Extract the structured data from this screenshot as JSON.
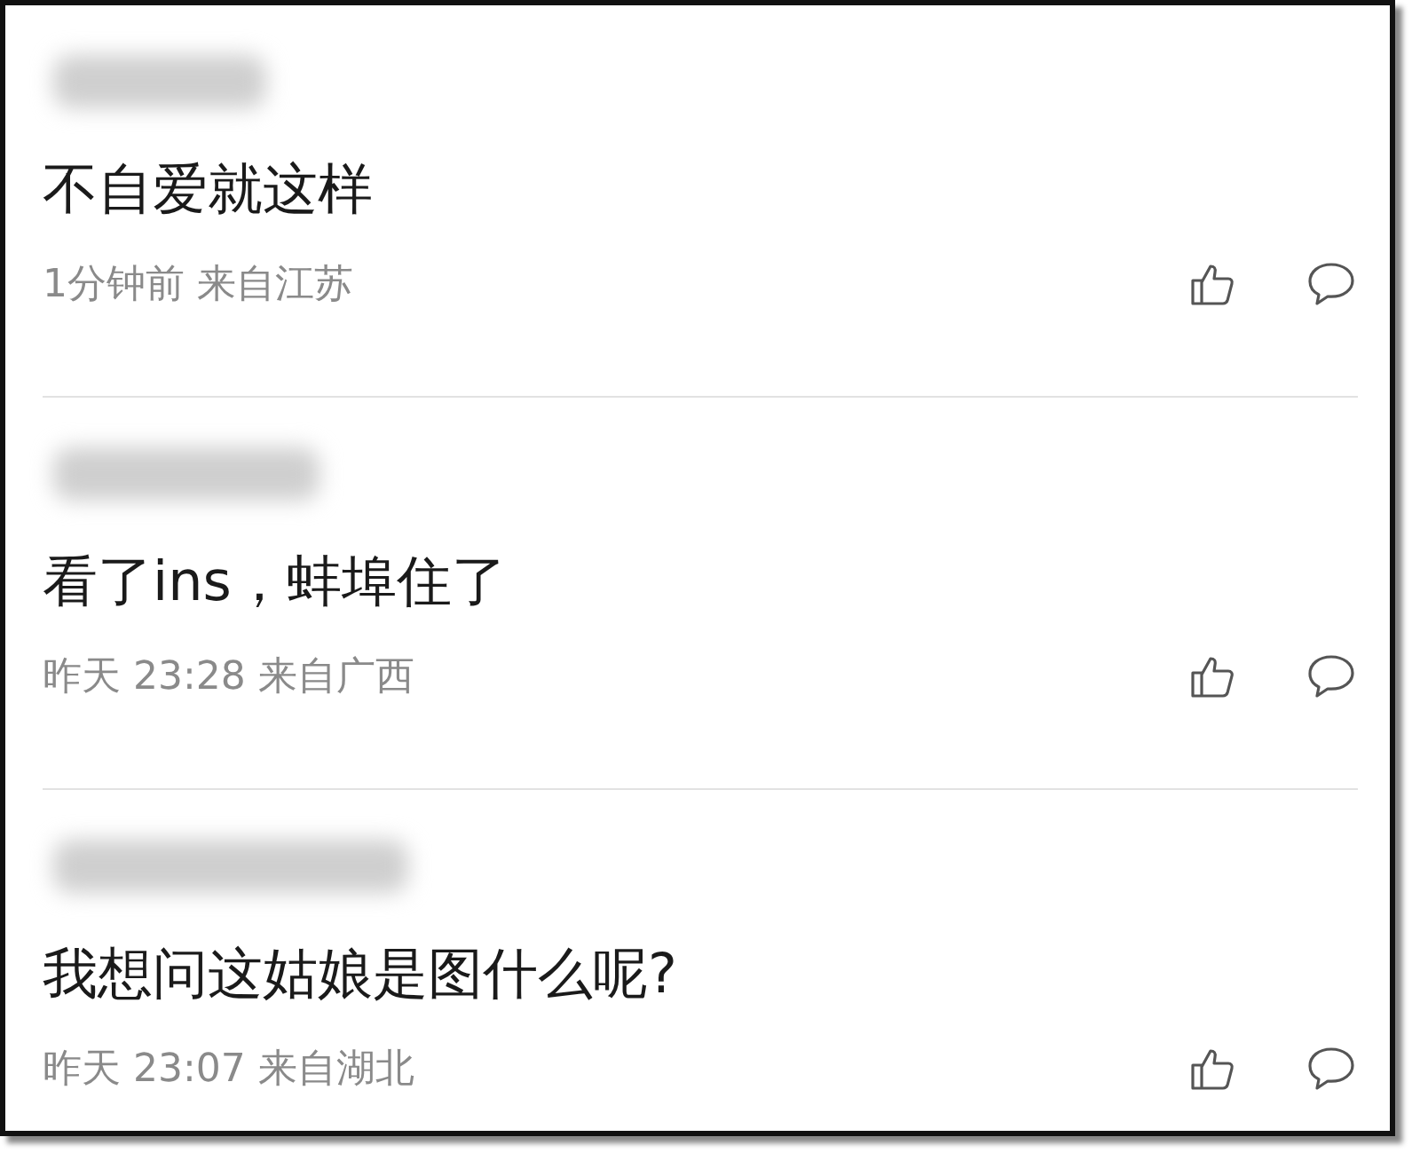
{
  "comments": [
    {
      "text": "不自爱就这样",
      "meta": "1分钟前 来自江苏"
    },
    {
      "text": "看了ins，蚌埠住了",
      "meta": "昨天 23:28 来自广西"
    },
    {
      "text": "我想问这姑娘是图什么呢?",
      "meta": "昨天 23:07 来自湖北"
    }
  ]
}
